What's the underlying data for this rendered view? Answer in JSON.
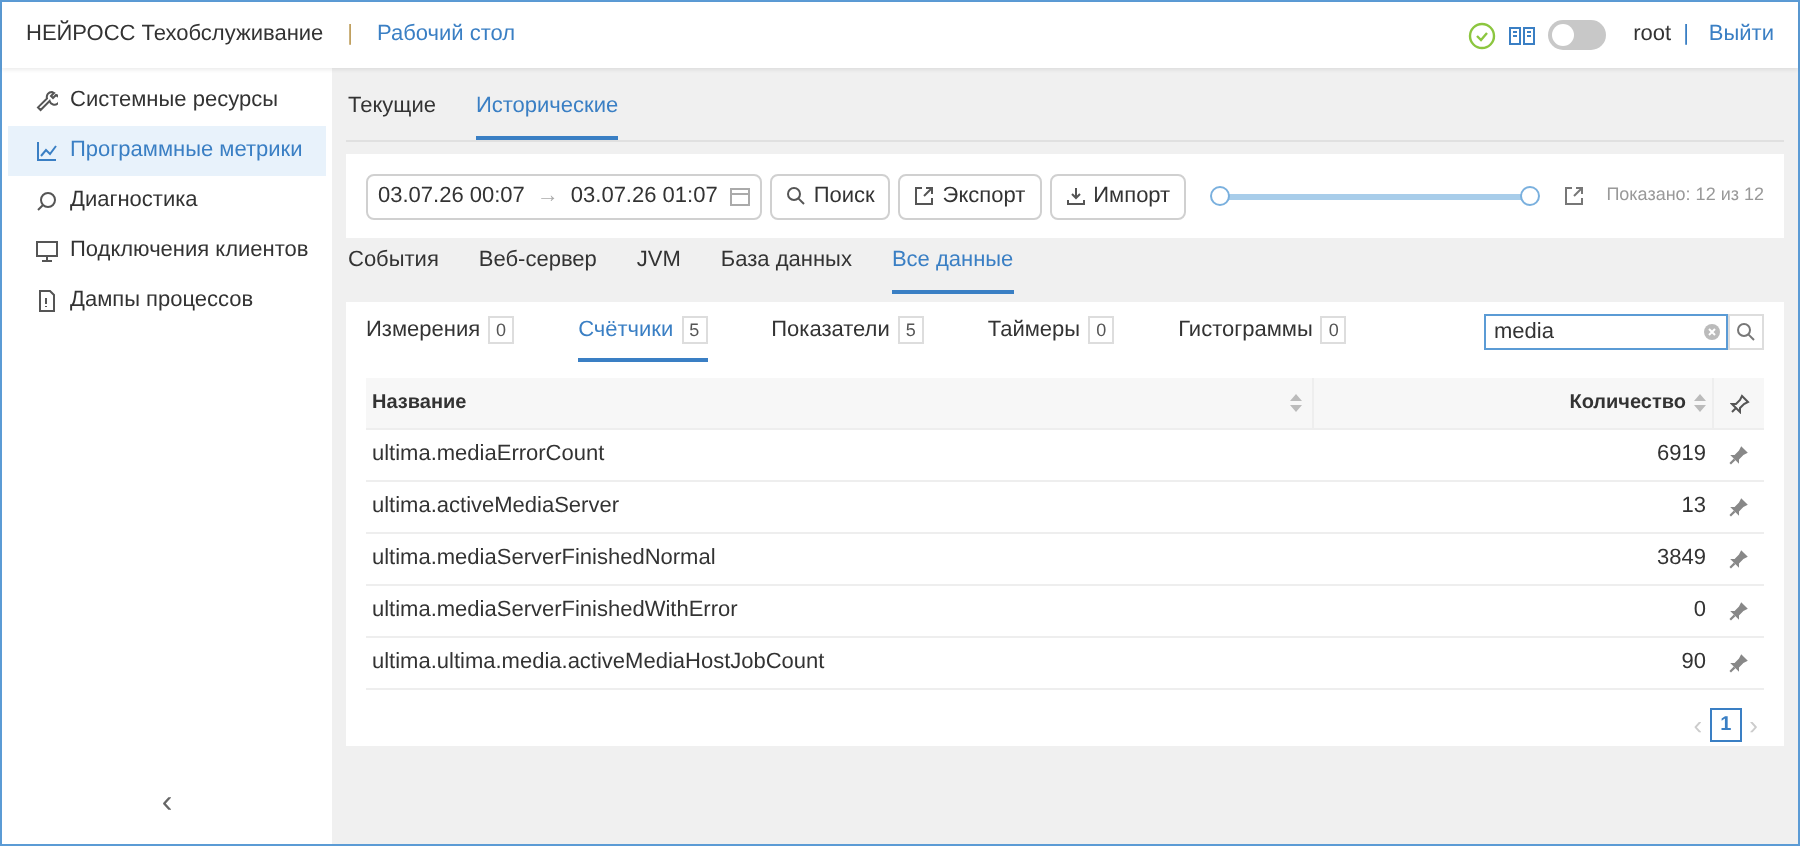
{
  "header": {
    "title": "НЕЙРОСС Техобслуживание",
    "separator": "|",
    "link": "Рабочий стол",
    "toggle": {
      "on": false
    },
    "user": "root",
    "user_separator": "|",
    "logout": "Выйти"
  },
  "sidebar": {
    "items": [
      {
        "label": "Системные ресурсы",
        "selected": false
      },
      {
        "label": "Программные метрики",
        "selected": true
      },
      {
        "label": "Диагностика",
        "selected": false
      },
      {
        "label": "Подключения клиентов",
        "selected": false
      },
      {
        "label": "Дампы процессов",
        "selected": false
      }
    ],
    "collapse": "‹"
  },
  "tabs": [
    {
      "label": "Текущие",
      "selected": false
    },
    {
      "label": "Исторические",
      "selected": true
    }
  ],
  "toolbar": {
    "date_from": "03.07.26 00:07",
    "arrow": "→",
    "date_to": "03.07.26 01:07",
    "buttons": [
      {
        "label": "Поиск"
      },
      {
        "label": "Экспорт"
      },
      {
        "label": "Импорт"
      }
    ],
    "slider": {
      "level": 1
    },
    "shown": "Показано: 12 из 12"
  },
  "category_tabs": [
    {
      "label": "События",
      "selected": false
    },
    {
      "label": "Веб-сервер",
      "selected": false
    },
    {
      "label": "JVM",
      "selected": false
    },
    {
      "label": "База данных",
      "selected": false
    },
    {
      "label": "Все данные",
      "selected": true
    }
  ],
  "metric_tabs": [
    {
      "label": "Измерения",
      "count": "0",
      "selected": false
    },
    {
      "label": "Счётчики",
      "count": "5",
      "selected": true
    },
    {
      "label": "Показатели",
      "count": "5",
      "selected": false
    },
    {
      "label": "Таймеры",
      "count": "0",
      "selected": false
    },
    {
      "label": "Гистограммы",
      "count": "0",
      "selected": false
    }
  ],
  "search": {
    "value": "media"
  },
  "table": {
    "columns": [
      "Название",
      "Количество"
    ],
    "rows": [
      {
        "name": "ultima.mediaErrorCount",
        "count": "6919"
      },
      {
        "name": "ultima.activeMediaServer",
        "count": "13"
      },
      {
        "name": "ultima.mediaServerFinishedNormal",
        "count": "3849"
      },
      {
        "name": "ultima.mediaServerFinishedWithError",
        "count": "0"
      },
      {
        "name": "ultima.ultima.media.activeMediaHostJobCount",
        "count": "90"
      }
    ]
  },
  "pagination": {
    "prev": "‹",
    "pages": [
      {
        "label": "1",
        "selected": true
      }
    ],
    "next": "›"
  }
}
